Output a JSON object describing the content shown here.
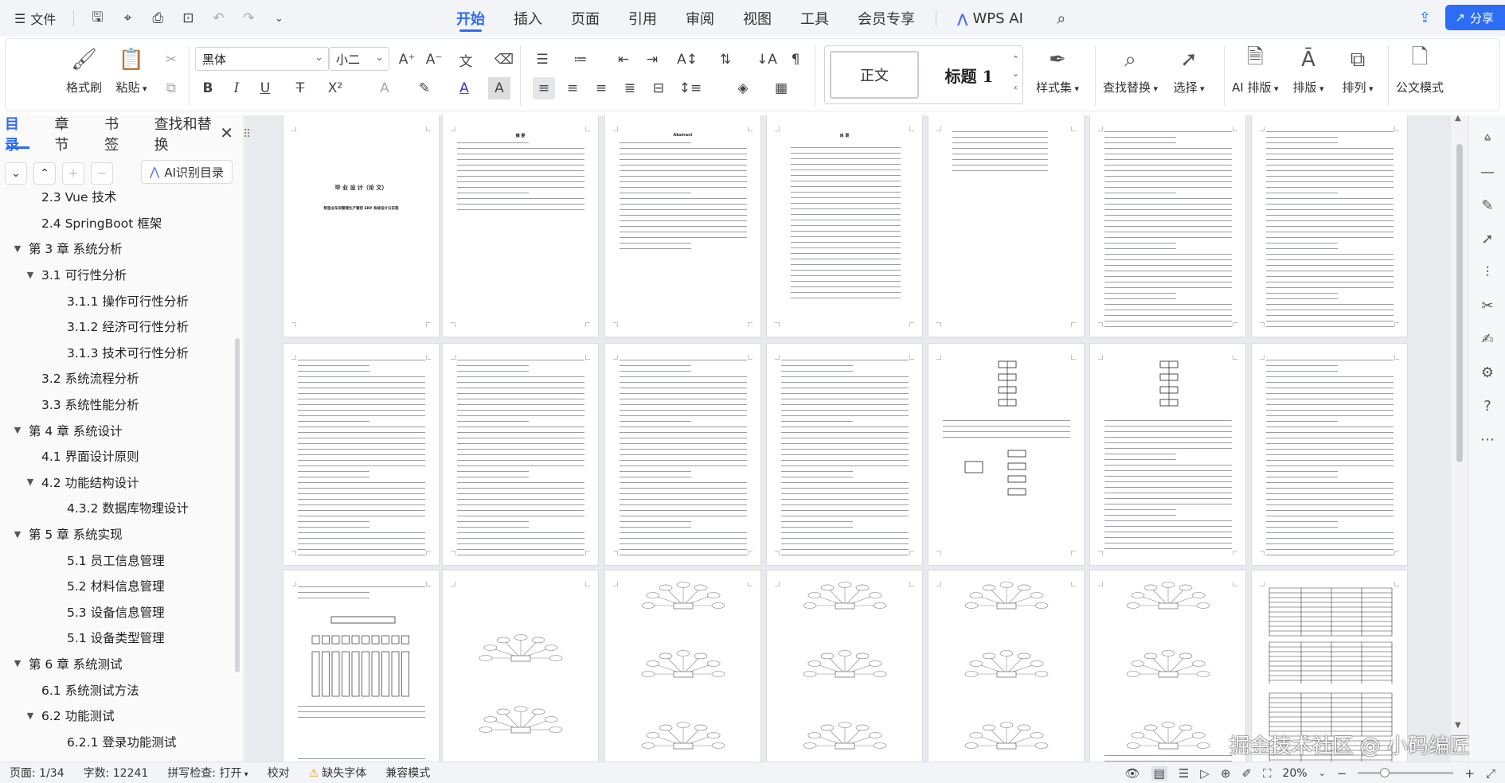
{
  "menubar": {
    "file_label": "文件",
    "tabs": [
      "开始",
      "插入",
      "页面",
      "引用",
      "审阅",
      "视图",
      "工具",
      "会员专享"
    ],
    "active_tab": "开始",
    "wps_ai": "WPS AI",
    "share": "分享"
  },
  "ribbon": {
    "format_painter": "格式刷",
    "paste": "粘贴",
    "font_name": "黑体",
    "font_size": "小二",
    "style_normal": "正文",
    "style_heading": "标题 1",
    "styles_set": "样式集",
    "find_replace": "查找替换",
    "select": "选择",
    "ai_layout": "AI 排版",
    "layout": "排版",
    "arrange": "排列",
    "official_doc": "公文模式"
  },
  "leftpane": {
    "tabs": [
      "目录",
      "章节",
      "书签",
      "查找和替换"
    ],
    "ai_toc": "AI识别目录",
    "toc": [
      {
        "label": "2.3 Vue 技术",
        "level": 2,
        "arrow": ""
      },
      {
        "label": "2.4 SpringBoot 框架",
        "level": 2,
        "arrow": ""
      },
      {
        "label": "第 3 章  系统分析",
        "level": 1,
        "arrow": "▼"
      },
      {
        "label": "3.1 可行性分析",
        "level": 2,
        "arrow": "▼"
      },
      {
        "label": "3.1.1 操作可行性分析",
        "level": 3,
        "arrow": ""
      },
      {
        "label": "3.1.2 经济可行性分析",
        "level": 3,
        "arrow": ""
      },
      {
        "label": "3.1.3 技术可行性分析",
        "level": 3,
        "arrow": ""
      },
      {
        "label": "3.2 系统流程分析",
        "level": 2,
        "arrow": ""
      },
      {
        "label": "3.3 系统性能分析",
        "level": 2,
        "arrow": ""
      },
      {
        "label": "第 4 章  系统设计",
        "level": 1,
        "arrow": "▼"
      },
      {
        "label": "4.1 界面设计原则",
        "level": 2,
        "arrow": ""
      },
      {
        "label": "4.2 功能结构设计",
        "level": 2,
        "arrow": "▼"
      },
      {
        "label": "4.3.2  数据库物理设计",
        "level": 3,
        "arrow": ""
      },
      {
        "label": "第 5 章  系统实现",
        "level": 1,
        "arrow": "▼"
      },
      {
        "label": "5.1 员工信息管理",
        "level": 3,
        "arrow": ""
      },
      {
        "label": "5.2  材料信息管理",
        "level": 3,
        "arrow": ""
      },
      {
        "label": "5.3 设备信息管理",
        "level": 3,
        "arrow": ""
      },
      {
        "label": "5.1 设备类型管理",
        "level": 3,
        "arrow": ""
      },
      {
        "label": "第 6 章  系统测试",
        "level": 1,
        "arrow": "▼"
      },
      {
        "label": "6.1  系统测试方法",
        "level": 2,
        "arrow": ""
      },
      {
        "label": "6.2  功能测试",
        "level": 2,
        "arrow": "▼"
      },
      {
        "label": "6.2.1  登录功能测试",
        "level": 3,
        "arrow": ""
      }
    ]
  },
  "document": {
    "cover_title": "毕 业 设 计（论 文）",
    "cover_subtitle": "制造业车间管理生产管控 ERP 系统设计与实现",
    "abstract_title_cn": "摘 要",
    "abstract_title_en": "Abstract",
    "toc_title": "目 录"
  },
  "statusbar": {
    "page": "页面: 1/34",
    "words": "字数: 12241",
    "spellcheck": "拼写检查: 打开",
    "proofread": "校对",
    "missing_font": "缺失字体",
    "compat_mode": "兼容模式",
    "zoom": "20%",
    "zoom_fraction": 0.28
  },
  "watermark": "掘金技术社区 @ 小码编匠"
}
